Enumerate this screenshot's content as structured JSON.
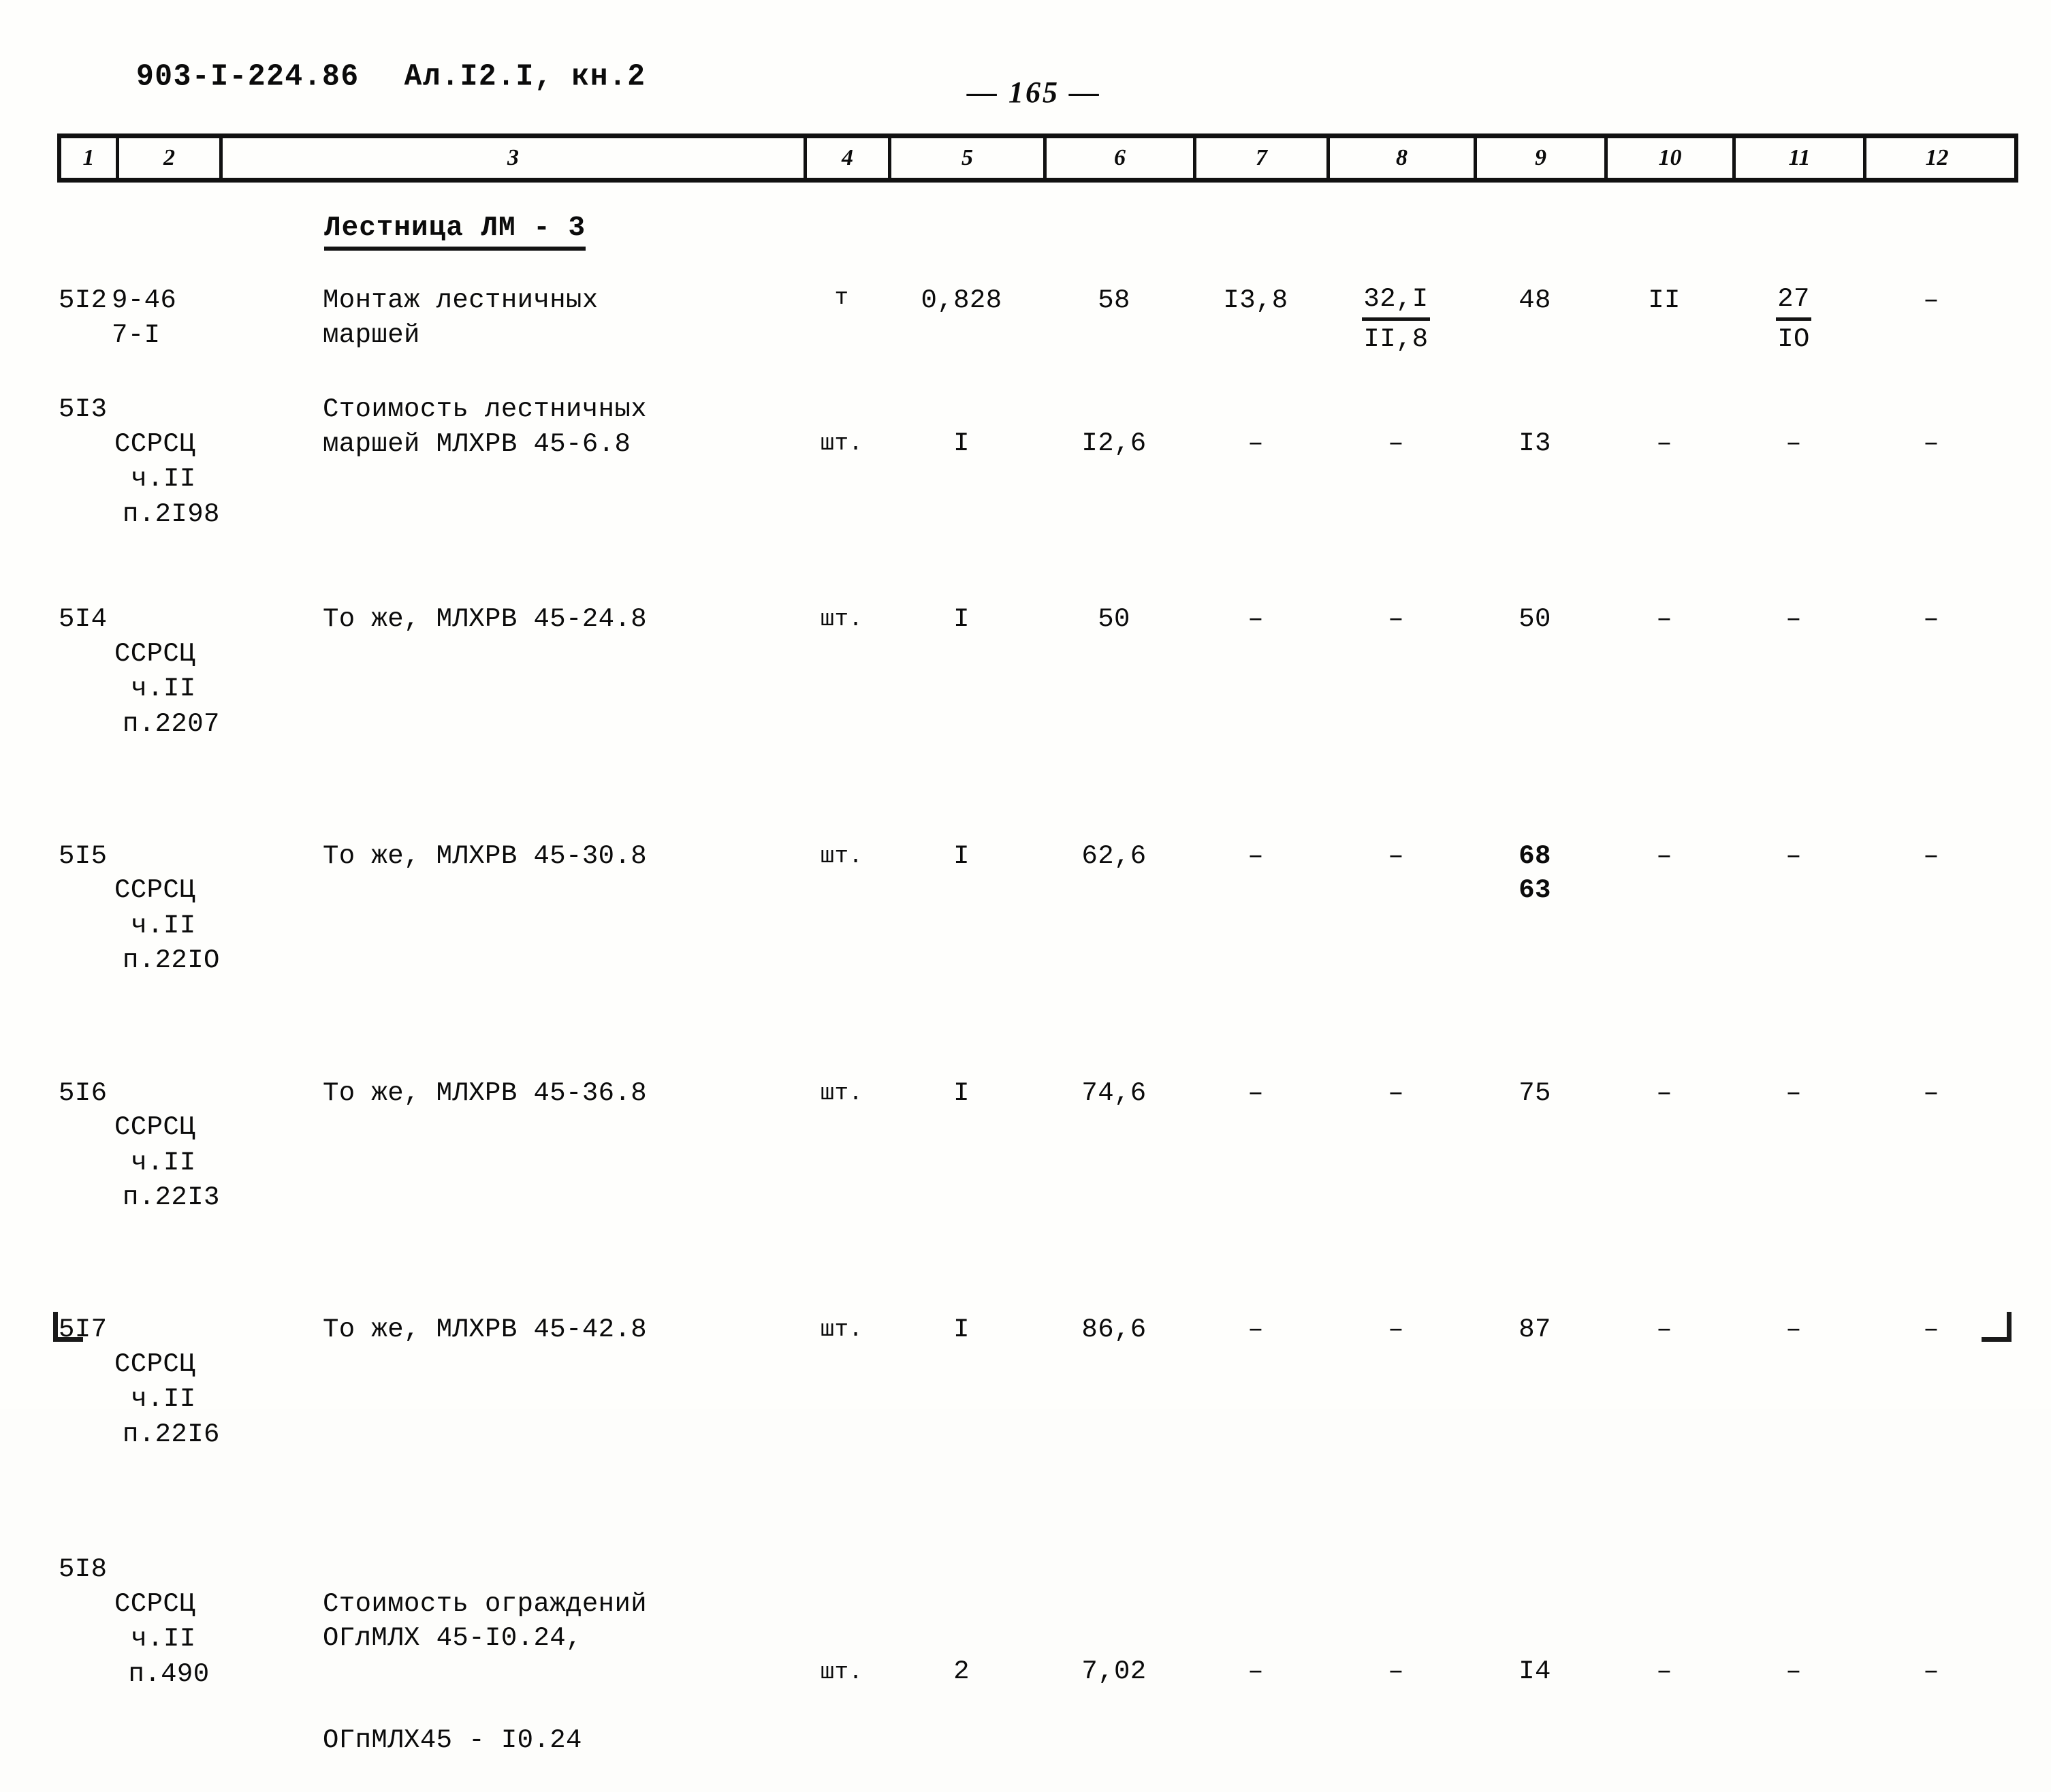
{
  "header": {
    "doc_code": "903-I-224.86",
    "album": "Ал.I2.I, кн.2",
    "page_number": "— 165 —"
  },
  "table": {
    "column_headers": [
      "1",
      "2",
      "3",
      "4",
      "5",
      "6",
      "7",
      "8",
      "9",
      "10",
      "11",
      "12"
    ],
    "section_title": "Лестница ЛМ - 3",
    "rows": [
      {
        "c1": "5I2",
        "c2": "9-46\n7-I",
        "c3": "Монтаж лестничных\nмаршей",
        "c4": "т",
        "c5": "0,828",
        "c6": "58",
        "c7": "I3,8",
        "c8_top": "32,I",
        "c8_bot": "II,8",
        "c9": "48",
        "c10": "II",
        "c11_top": "27",
        "c11_bot": "IO",
        "c12": "–"
      },
      {
        "c1": "5I3",
        "c2_l1": "ССРСЦ",
        "c2_l2": "ч.II",
        "c2_l3": "п.2I98",
        "c3": "Стоимость лестничных\nмаршей МЛХРВ 45-6.8",
        "c4": "шт.",
        "c5": "I",
        "c6": "I2,6",
        "c7": "–",
        "c8": "–",
        "c9": "I3",
        "c10": "–",
        "c11": "–",
        "c12": "–"
      },
      {
        "c1": "5I4",
        "c2_l1": "ССРСЦ",
        "c2_l2": "ч.II",
        "c2_l3": "п.2207",
        "c3": "То же, МЛХРВ 45-24.8",
        "c4": "шт.",
        "c5": "I",
        "c6": "50",
        "c7": "–",
        "c8": "–",
        "c9": "50",
        "c10": "–",
        "c11": "–",
        "c12": "–"
      },
      {
        "c1": "5I5",
        "c2_l1": "ССРСЦ",
        "c2_l2": "ч.II",
        "c2_l3": "п.22IO",
        "c3": "То же, МЛХРВ 45-30.8",
        "c4": "шт.",
        "c5": "I",
        "c6": "62,6",
        "c7": "–",
        "c8": "–",
        "c9": "63",
        "c9_overstruck": "68",
        "c10": "–",
        "c11": "–",
        "c12": "–"
      },
      {
        "c1": "5I6",
        "c2_l1": "ССРСЦ",
        "c2_l2": "ч.II",
        "c2_l3": "п.22I3",
        "c3": "То же, МЛХРВ 45-36.8",
        "c4": "шт.",
        "c5": "I",
        "c6": "74,6",
        "c7": "–",
        "c8": "–",
        "c9": "75",
        "c10": "–",
        "c11": "–",
        "c12": "–"
      },
      {
        "c1": "5I7",
        "c2_l1": "ССРСЦ",
        "c2_l2": "ч.II",
        "c2_l3": "п.22I6",
        "c3": "То же, МЛХРВ 45-42.8",
        "c4": "шт.",
        "c5": "I",
        "c6": "86,6",
        "c7": "–",
        "c8": "–",
        "c9": "87",
        "c10": "–",
        "c11": "–",
        "c12": "–"
      },
      {
        "c1": "5I8",
        "c2_l1": "ССРСЦ",
        "c2_l2": "ч.II",
        "c2_l3": "п.490",
        "c3": "Стоимость ограждений\nОГлМЛХ 45-I0.24,",
        "c3_b": "ОГпМЛХ45 - I0.24",
        "c4": "шт.",
        "c5": "2",
        "c6": "7,02",
        "c7": "–",
        "c8": "–",
        "c9": "I4",
        "c10": "–",
        "c11": "–",
        "c12": "–"
      }
    ]
  }
}
